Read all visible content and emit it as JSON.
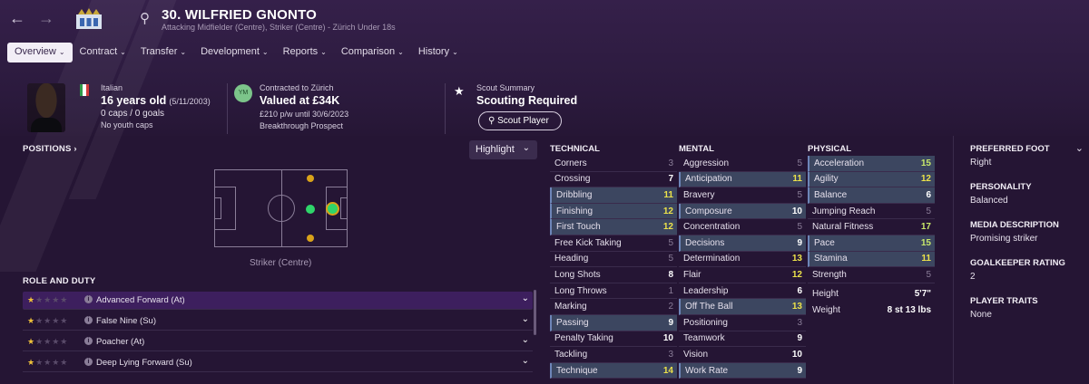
{
  "header": {
    "player_title": "30. WILFRIED GNONTO",
    "positions_line": "Attacking Midfielder (Centre), Striker (Centre) - Zürich Under 18s"
  },
  "menu": [
    {
      "label": "Overview",
      "active": true
    },
    {
      "label": "Contract"
    },
    {
      "label": "Transfer"
    },
    {
      "label": "Development"
    },
    {
      "label": "Reports"
    },
    {
      "label": "Comparison"
    },
    {
      "label": "History"
    }
  ],
  "bio": {
    "nationality": "Italian",
    "age": "16 years old",
    "dob": "(5/11/2003)",
    "caps": "0 caps / 0 goals",
    "youth": "No youth caps"
  },
  "contract": {
    "badge": "YM",
    "line1": "Contracted to Zürich",
    "value": "Valued at £34K",
    "wage": "£210 p/w until 30/6/2023",
    "status": "Breakthrough Prospect"
  },
  "scout": {
    "label": "Scout Summary",
    "status": "Scouting Required",
    "button": "Scout Player"
  },
  "positions": {
    "title": "POSITIONS",
    "caption": "Striker (Centre)",
    "highlight_label": "Highlight"
  },
  "roles": {
    "title": "ROLE AND DUTY",
    "items": [
      {
        "name": "Advanced Forward (At)",
        "stars": 1
      },
      {
        "name": "False Nine (Su)",
        "stars": 1
      },
      {
        "name": "Poacher (At)",
        "stars": 1
      },
      {
        "name": "Deep Lying Forward (Su)",
        "stars": 1
      }
    ]
  },
  "technical": {
    "title": "TECHNICAL",
    "rows": [
      {
        "name": "Corners",
        "value": "3",
        "hl": false
      },
      {
        "name": "Crossing",
        "value": "7",
        "hl": false
      },
      {
        "name": "Dribbling",
        "value": "11",
        "hl": true
      },
      {
        "name": "Finishing",
        "value": "12",
        "hl": true
      },
      {
        "name": "First Touch",
        "value": "12",
        "hl": true
      },
      {
        "name": "Free Kick Taking",
        "value": "5",
        "hl": false
      },
      {
        "name": "Heading",
        "value": "5",
        "hl": false
      },
      {
        "name": "Long Shots",
        "value": "8",
        "hl": false
      },
      {
        "name": "Long Throws",
        "value": "1",
        "hl": false
      },
      {
        "name": "Marking",
        "value": "2",
        "hl": false
      },
      {
        "name": "Passing",
        "value": "9",
        "hl": true
      },
      {
        "name": "Penalty Taking",
        "value": "10",
        "hl": false
      },
      {
        "name": "Tackling",
        "value": "3",
        "hl": false
      },
      {
        "name": "Technique",
        "value": "14",
        "hl": true
      }
    ]
  },
  "mental": {
    "title": "MENTAL",
    "rows": [
      {
        "name": "Aggression",
        "value": "5",
        "hl": false
      },
      {
        "name": "Anticipation",
        "value": "11",
        "hl": true
      },
      {
        "name": "Bravery",
        "value": "5",
        "hl": false
      },
      {
        "name": "Composure",
        "value": "10",
        "hl": true
      },
      {
        "name": "Concentration",
        "value": "5",
        "hl": false
      },
      {
        "name": "Decisions",
        "value": "9",
        "hl": true
      },
      {
        "name": "Determination",
        "value": "13",
        "hl": false
      },
      {
        "name": "Flair",
        "value": "12",
        "hl": false
      },
      {
        "name": "Leadership",
        "value": "6",
        "hl": false
      },
      {
        "name": "Off The Ball",
        "value": "13",
        "hl": true
      },
      {
        "name": "Positioning",
        "value": "3",
        "hl": false
      },
      {
        "name": "Teamwork",
        "value": "9",
        "hl": false
      },
      {
        "name": "Vision",
        "value": "10",
        "hl": false
      },
      {
        "name": "Work Rate",
        "value": "9",
        "hl": true
      }
    ]
  },
  "physical": {
    "title": "PHYSICAL",
    "rows": [
      {
        "name": "Acceleration",
        "value": "15",
        "hl": true
      },
      {
        "name": "Agility",
        "value": "12",
        "hl": true
      },
      {
        "name": "Balance",
        "value": "6",
        "hl": true
      },
      {
        "name": "Jumping Reach",
        "value": "5",
        "hl": false
      },
      {
        "name": "Natural Fitness",
        "value": "17",
        "hl": false
      },
      {
        "name": "Pace",
        "value": "15",
        "hl": true
      },
      {
        "name": "Stamina",
        "value": "11",
        "hl": true
      },
      {
        "name": "Strength",
        "value": "5",
        "hl": false
      }
    ],
    "height_label": "Height",
    "height": "5'7\"",
    "weight_label": "Weight",
    "weight": "8 st 13 lbs"
  },
  "side": {
    "foot_label": "PREFERRED FOOT",
    "foot": "Right",
    "personality_label": "PERSONALITY",
    "personality": "Balanced",
    "media_label": "MEDIA DESCRIPTION",
    "media": "Promising striker",
    "gk_label": "GOALKEEPER RATING",
    "gk": "2",
    "traits_label": "PLAYER TRAITS",
    "traits": "None"
  }
}
